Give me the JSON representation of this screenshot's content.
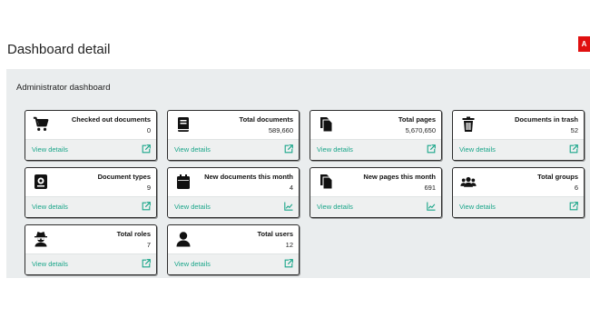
{
  "page": {
    "title": "Dashboard detail",
    "corner_badge": "A"
  },
  "panel": {
    "title": "Administrator dashboard"
  },
  "colors": {
    "accent": "#19a589",
    "panel_bg": "#eaedee",
    "badge": "#e01010"
  },
  "cards": [
    {
      "label": "Checked out documents",
      "value": "0",
      "icon": "cart-icon",
      "link": "View details",
      "footer_icon": "external-link-icon"
    },
    {
      "label": "Total documents",
      "value": "589,660",
      "icon": "book-icon",
      "link": "View details",
      "footer_icon": "external-link-icon"
    },
    {
      "label": "Total pages",
      "value": "5,670,650",
      "icon": "pages-icon",
      "link": "View details",
      "footer_icon": "external-link-icon"
    },
    {
      "label": "Documents in trash",
      "value": "52",
      "icon": "trash-icon",
      "link": "View details",
      "footer_icon": "external-link-icon"
    },
    {
      "label": "Document types",
      "value": "9",
      "icon": "document-type-icon",
      "link": "View details",
      "footer_icon": "external-link-icon"
    },
    {
      "label": "New documents this month",
      "value": "4",
      "icon": "calendar-icon",
      "link": "View details",
      "footer_icon": "line-chart-icon"
    },
    {
      "label": "New pages this month",
      "value": "691",
      "icon": "pages-icon",
      "link": "View details",
      "footer_icon": "line-chart-icon"
    },
    {
      "label": "Total groups",
      "value": "6",
      "icon": "users-icon",
      "link": "View details",
      "footer_icon": "external-link-icon"
    },
    {
      "label": "Total roles",
      "value": "7",
      "icon": "user-secret-icon",
      "link": "View details",
      "footer_icon": "external-link-icon"
    },
    {
      "label": "Total users",
      "value": "12",
      "icon": "user-icon",
      "link": "View details",
      "footer_icon": "external-link-icon"
    }
  ]
}
